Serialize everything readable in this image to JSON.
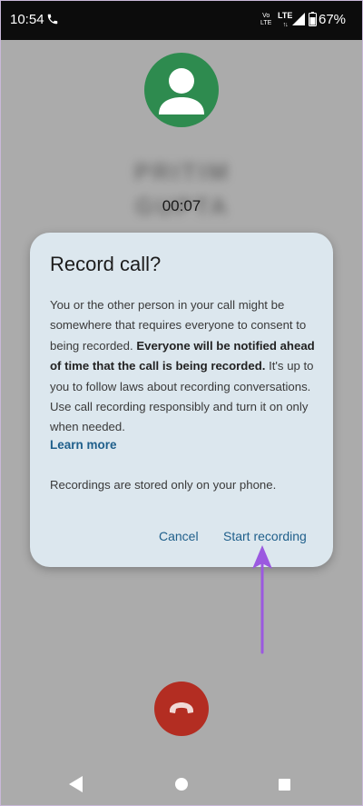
{
  "status_bar": {
    "time": "10:54",
    "volte_top": "Vo",
    "volte_bottom": "LTE",
    "network": "LTE",
    "battery_percent": "67%",
    "icons": [
      "phone-call-icon",
      "signal-icon",
      "battery-icon"
    ]
  },
  "call": {
    "caller_name": "PRITIM GUPTA",
    "duration": "00:07",
    "avatar_color": "#2e8b4f"
  },
  "dialog": {
    "title": "Record call?",
    "body_part1": "You or the other person in your call might be somewhere that requires everyone to consent to being recorded. ",
    "body_bold": "Everyone will be notified ahead of time that the call is being recorded.",
    "body_part2": " It's up to you to follow laws about recording conversations. Use call recording responsibly and turn it on only when needed.",
    "learn_more": "Learn more",
    "storage_note": "Recordings are stored only on your phone.",
    "cancel_label": "Cancel",
    "start_label": "Start recording",
    "background": "#dce7ee",
    "accent": "#1f5f8b"
  },
  "annotation": {
    "color": "#9b59e0"
  },
  "end_call": {
    "color": "#b32d22",
    "icon": "end-call-icon"
  },
  "nav": {
    "icons": [
      "back-icon",
      "home-icon",
      "recents-icon"
    ]
  }
}
